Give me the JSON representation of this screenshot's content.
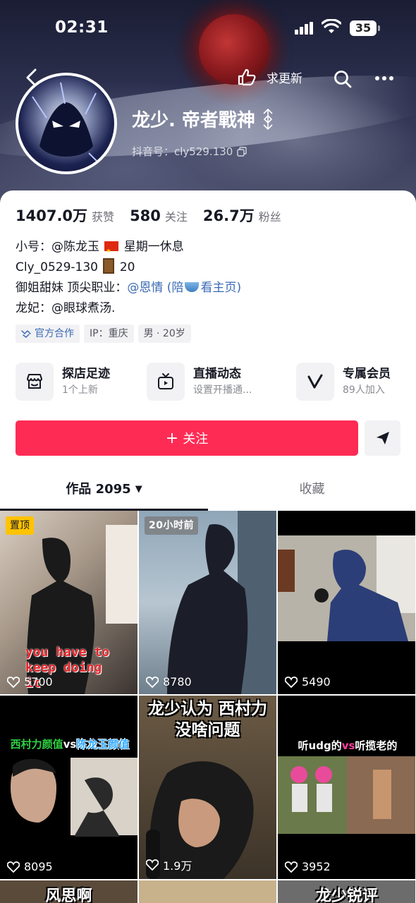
{
  "status": {
    "time": "02:31",
    "battery": "35"
  },
  "header": {
    "update_label": "求更新"
  },
  "profile": {
    "nickname": "龙少. 帝者戰神",
    "douyin_id": "抖音号：cly529.130"
  },
  "stats": [
    {
      "value": "1407.0万",
      "label": "获赞"
    },
    {
      "value": "580",
      "label": "关注"
    },
    {
      "value": "26.7万",
      "label": "粉丝"
    }
  ],
  "bio": {
    "line1_prefix": "小号：@陈龙玉",
    "line1_suffix": "星期一休息",
    "line2_prefix": "Cly_0529-130",
    "line2_suffix": "20",
    "line3_prefix": "御姐甜妹 顶尖职业：",
    "line3_link_a": "@恩情 (陪",
    "line3_link_b": "看主页)",
    "line4": "龙妃：@眼球煮汤."
  },
  "tags": {
    "official": "官方合作",
    "ip": "IP：重庆",
    "gender_age": "男 · 20岁"
  },
  "features": [
    {
      "title": "探店足迹",
      "sub": "1个上新",
      "icon": "store-icon"
    },
    {
      "title": "直播动态",
      "sub": "设置开播通...",
      "icon": "tv-icon"
    },
    {
      "title": "专属会员",
      "sub": "89人加入",
      "icon": "v-icon"
    }
  ],
  "follow_label": "关注",
  "tabs": {
    "works": "作品 2095",
    "collect": "收藏"
  },
  "videos": [
    {
      "likes": "5700",
      "badge": "置顶",
      "caption": "you have to keep doing it"
    },
    {
      "likes": "8780",
      "badge": "20小时前",
      "caption": ""
    },
    {
      "likes": "5490",
      "badge": "",
      "caption": ""
    },
    {
      "likes": "8095",
      "badge": "",
      "caption_a": "西村力颜值",
      "caption_vs": "vs",
      "caption_b": "陈龙玉颜值"
    },
    {
      "likes": "1.9万",
      "badge": "",
      "caption": "龙少认为 西村力 没啥问题"
    },
    {
      "likes": "3952",
      "badge": "",
      "caption_a": "听udg的",
      "caption_vs": "vs",
      "caption_b": "听揽老的"
    },
    {
      "caption": "风思啊"
    },
    {
      "caption": ""
    },
    {
      "caption": "龙少锐评"
    }
  ],
  "colors": {
    "accent": "#fe2c55",
    "link": "#3b6ab5",
    "pin_badge": "#ffc300"
  }
}
